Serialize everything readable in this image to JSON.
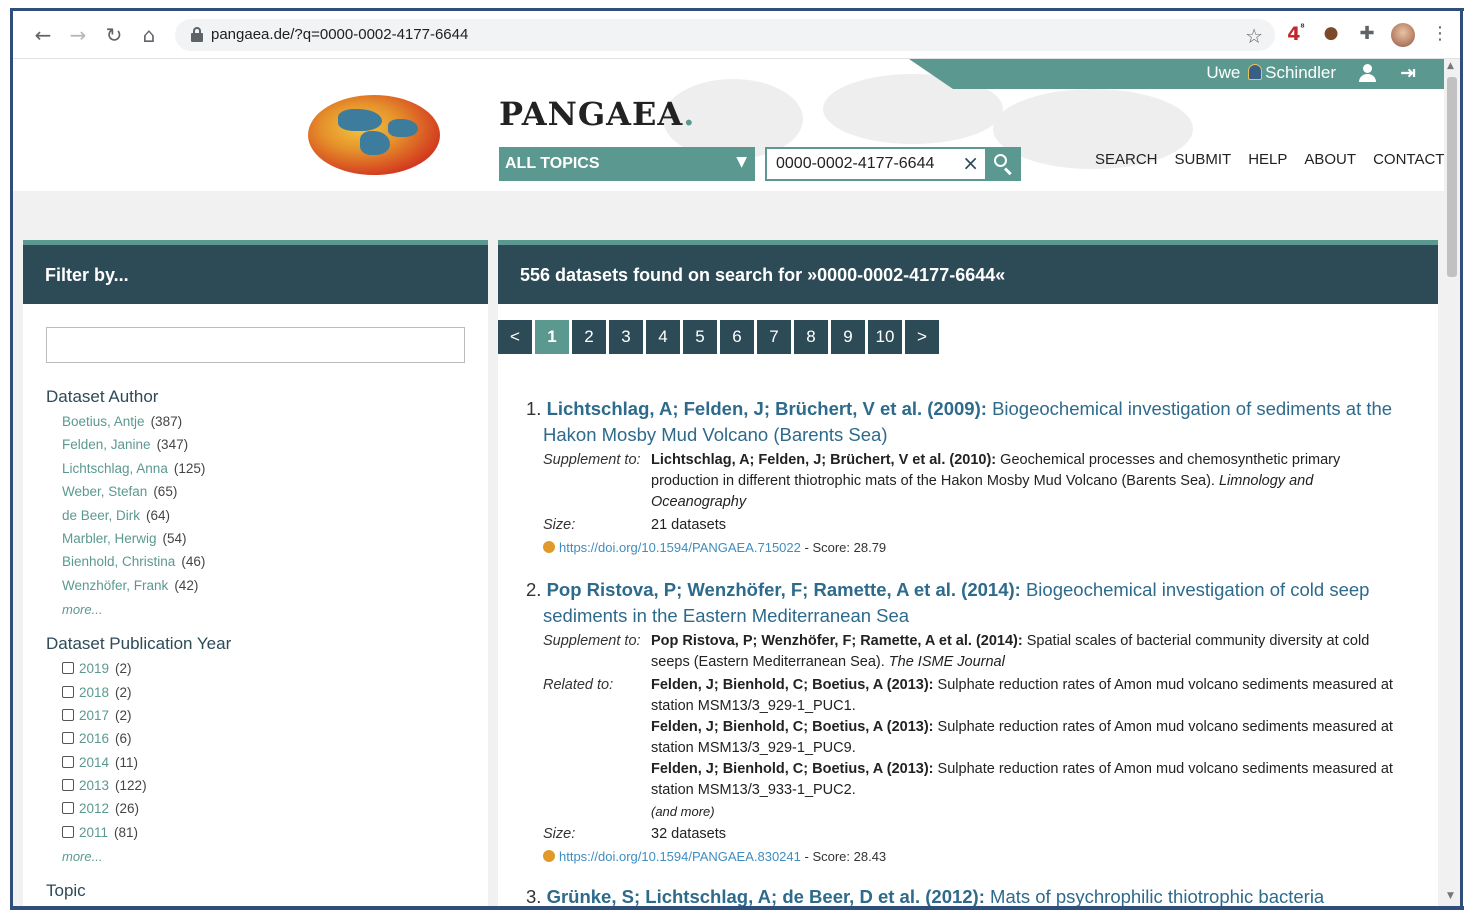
{
  "browser": {
    "url": "pangaea.de/?q=0000-0002-4177-6644",
    "extension_badge": "4"
  },
  "header": {
    "brand": "PANGAEA",
    "brand_dot": ".",
    "user_first": "Uwe",
    "user_last": "Schindler",
    "topic_select": "ALL TOPICS",
    "search_value": "0000-0002-4177-6644",
    "nav": [
      "SEARCH",
      "SUBMIT",
      "HELP",
      "ABOUT",
      "CONTACT"
    ]
  },
  "filter": {
    "title": "Filter by...",
    "author_title": "Dataset Author",
    "authors": [
      {
        "name": "Boetius, Antje",
        "count": "(387)"
      },
      {
        "name": "Felden, Janine",
        "count": "(347)"
      },
      {
        "name": "Lichtschlag, Anna",
        "count": "(125)"
      },
      {
        "name": "Weber, Stefan",
        "count": "(65)"
      },
      {
        "name": "de Beer, Dirk",
        "count": "(64)"
      },
      {
        "name": "Marbler, Herwig",
        "count": "(54)"
      },
      {
        "name": "Bienhold, Christina",
        "count": "(46)"
      },
      {
        "name": "Wenzhöfer, Frank",
        "count": "(42)"
      }
    ],
    "more": "more...",
    "year_title": "Dataset Publication Year",
    "years": [
      {
        "name": "2019",
        "count": "(2)"
      },
      {
        "name": "2018",
        "count": "(2)"
      },
      {
        "name": "2017",
        "count": "(2)"
      },
      {
        "name": "2016",
        "count": "(6)"
      },
      {
        "name": "2014",
        "count": "(11)"
      },
      {
        "name": "2013",
        "count": "(122)"
      },
      {
        "name": "2012",
        "count": "(26)"
      },
      {
        "name": "2011",
        "count": "(81)"
      }
    ],
    "topic_title": "Topic"
  },
  "results": {
    "heading": "556 datasets found on search for »0000-0002-4177-6644«",
    "pages": [
      "<",
      "1",
      "2",
      "3",
      "4",
      "5",
      "6",
      "7",
      "8",
      "9",
      "10",
      ">"
    ],
    "current_page": "1",
    "labels": {
      "supplement": "Supplement to:",
      "related": "Related to:",
      "size": "Size:",
      "and_more": "(and more)"
    },
    "items": [
      {
        "num": "1.",
        "authors": "Lichtschlag, A; Felden, J; Brüchert, V et al. (2009):",
        "title": "Biogeochemical investigation of sediments at the Hakon Mosby Mud Volcano (Barents Sea)",
        "supp_authors": "Lichtschlag, A; Felden, J; Brüchert, V et al. (2010):",
        "supp_text": "Geochemical processes and chemosynthetic primary production in different thiotrophic mats of the Hakon Mosby Mud Volcano (Barents Sea).",
        "supp_journal": "Limnology and Oceanography",
        "size": "21 datasets",
        "doi": "https://doi.org/10.1594/PANGAEA.715022",
        "score": "- Score: 28.79"
      },
      {
        "num": "2.",
        "authors": "Pop Ristova, P; Wenzhöfer, F; Ramette, A et al. (2014):",
        "title": "Biogeochemical investigation of cold seep sediments in the Eastern Mediterranean Sea",
        "supp_authors": "Pop Ristova, P; Wenzhöfer, F; Ramette, A et al. (2014):",
        "supp_text": "Spatial scales of bacterial community diversity at cold seeps (Eastern Mediterranean Sea).",
        "supp_journal": "The ISME Journal",
        "related": [
          {
            "authors": "Felden, J; Bienhold, C; Boetius, A (2013):",
            "text": "Sulphate reduction rates of Amon mud volcano sediments measured at station MSM13/3_929-1_PUC1."
          },
          {
            "authors": "Felden, J; Bienhold, C; Boetius, A (2013):",
            "text": "Sulphate reduction rates of Amon mud volcano sediments measured at station MSM13/3_929-1_PUC9."
          },
          {
            "authors": "Felden, J; Bienhold, C; Boetius, A (2013):",
            "text": "Sulphate reduction rates of Amon mud volcano sediments measured at station MSM13/3_933-1_PUC2."
          }
        ],
        "size": "32 datasets",
        "doi": "https://doi.org/10.1594/PANGAEA.830241",
        "score": "- Score: 28.43"
      },
      {
        "num": "3.",
        "authors": "Grünke, S; Lichtschlag, A; de Beer, D et al. (2012):",
        "title": "Mats of psychrophilic thiotrophic bacteria"
      }
    ]
  },
  "colors": {
    "teal": "#5b9990",
    "navy": "#2d4a57",
    "link": "#2d6a8c"
  }
}
